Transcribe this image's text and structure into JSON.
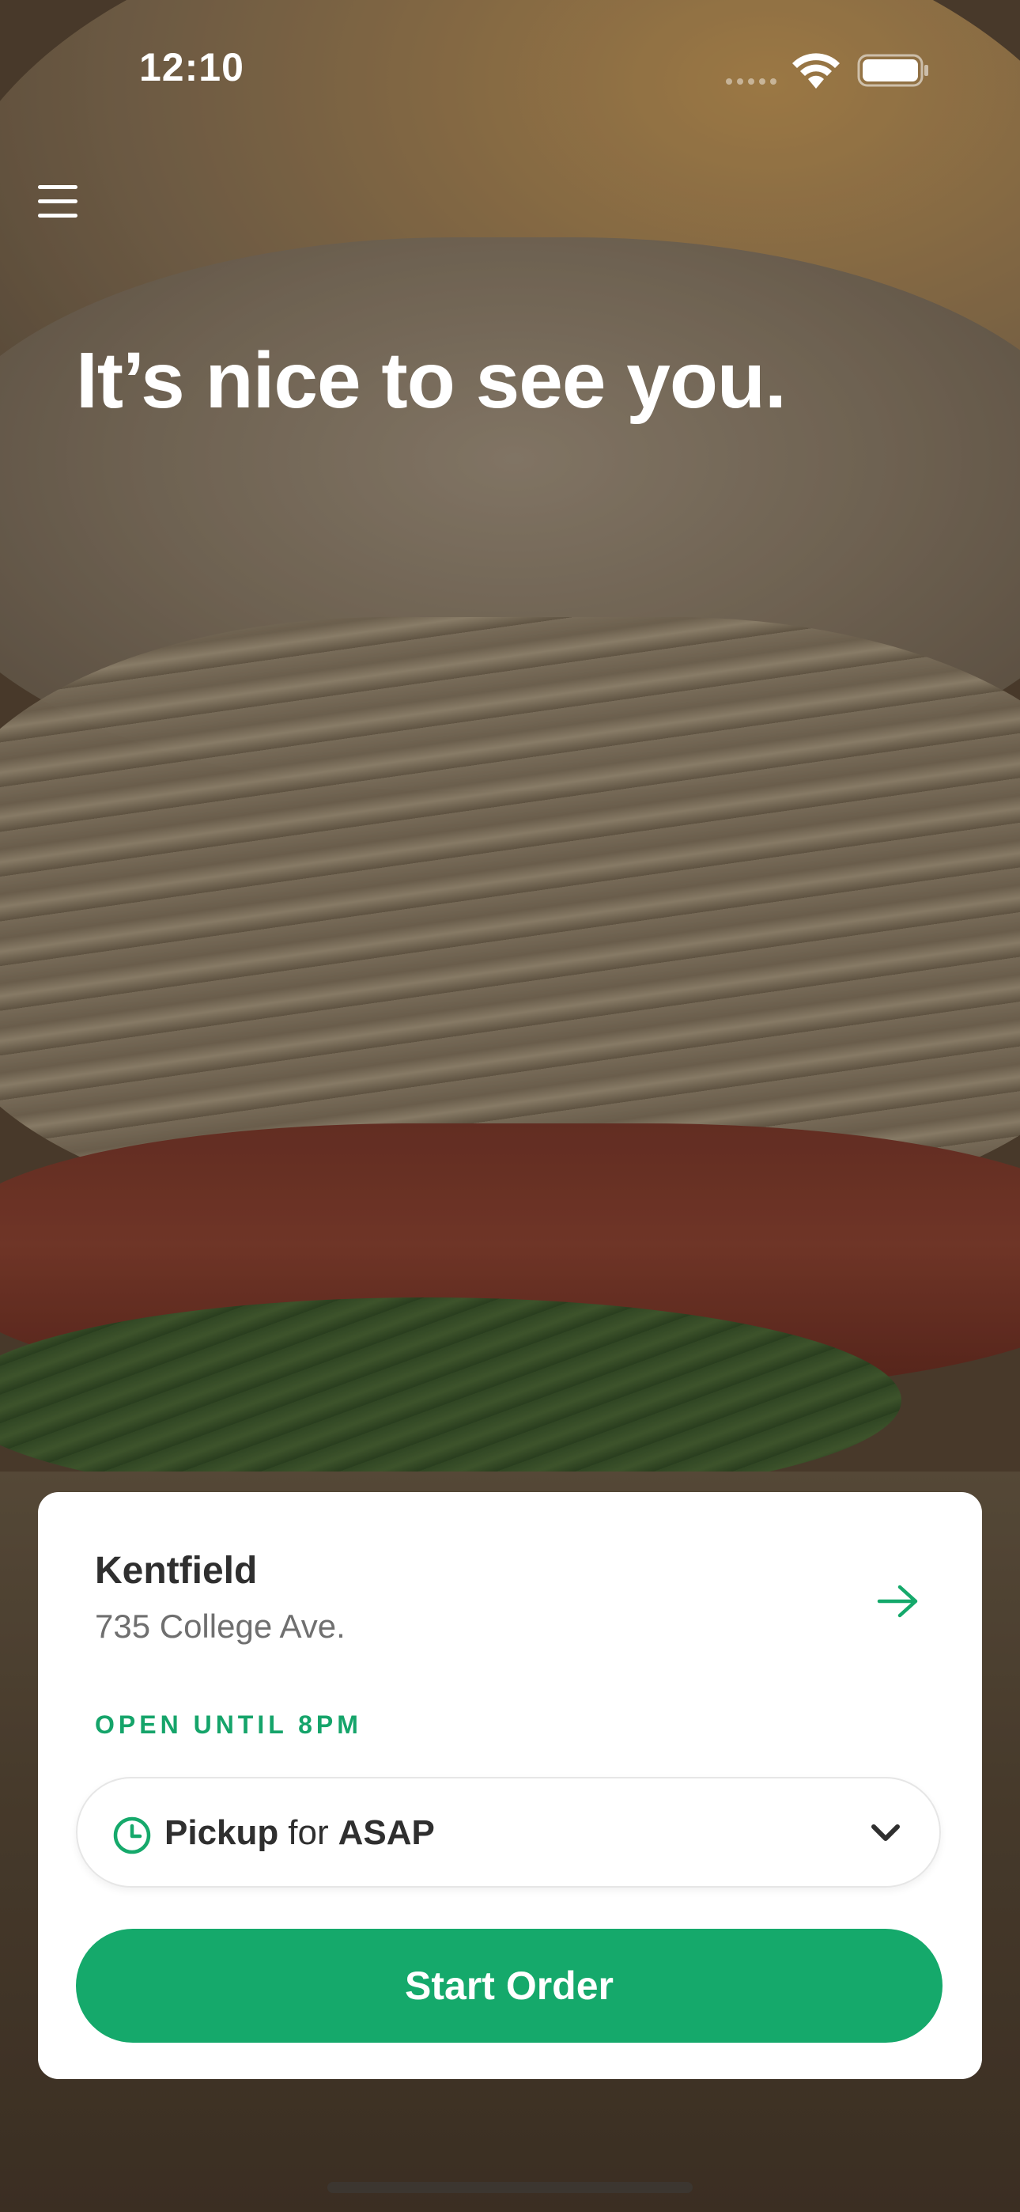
{
  "status_bar": {
    "time": "12:10"
  },
  "header": {
    "greeting": "It’s nice to see you."
  },
  "store_card": {
    "name": "Kentfield",
    "address": "735 College Ave.",
    "hours": "OPEN UNTIL 8PM",
    "order_type": "Pickup",
    "connector": "for",
    "order_time": "ASAP",
    "start_button": "Start Order"
  },
  "colors": {
    "accent": "#15a96b",
    "hours_text": "#15a46a"
  },
  "icons": [
    "signal-icon",
    "wifi-icon",
    "battery-icon",
    "menu-icon",
    "arrow-right-icon",
    "clock-icon",
    "chevron-down-icon"
  ]
}
